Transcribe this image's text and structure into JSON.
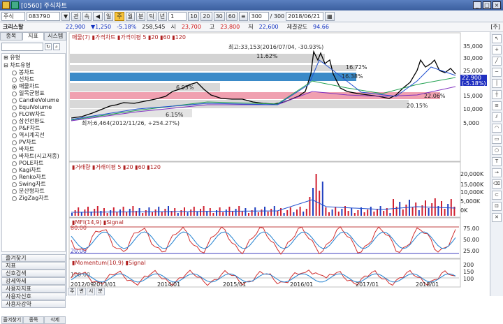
{
  "window": {
    "title": "[0560] 주식차트"
  },
  "toolbar": {
    "market": "주식",
    "code": "083790",
    "btn_kwan": "관",
    "btn_sok": "속",
    "period_day": "일",
    "period_week": "주",
    "period_month": "월",
    "period_minute": "분",
    "period_tick": "틱",
    "period_year": "년",
    "interval_value": "1",
    "presets": [
      "10",
      "20",
      "30",
      "60"
    ],
    "count_value": "300",
    "count_total": "/ 300",
    "date_value": "2018/06/21"
  },
  "quote": {
    "name": "크리스탈",
    "price": "22,900",
    "change": "▼1,250",
    "change_pct": "-5.18%",
    "volume": "258,545",
    "open_label": "시",
    "open": "23,700",
    "high_label": "고",
    "high": "23,800",
    "low_label": "저",
    "low": "22,600",
    "strength_label": "체결강도",
    "strength": "94.66",
    "tag": "[주]"
  },
  "sidebar": {
    "tabs": [
      "종목",
      "지표",
      "시스템"
    ],
    "active_tab": "지표",
    "groups": {
      "indicator": "유형",
      "chart_type": "차트유형"
    },
    "items": [
      "봉차트",
      "선차트",
      "매물차트",
      "일목균형표",
      "CandleVolume",
      "EquiVolume",
      "FLOW차트",
      "삼선전환도",
      "P&F차트",
      "역시계곡선",
      "PV차트",
      "바차트",
      "바차트(시고저종)",
      "POLE차트",
      "Kagi차트",
      "Renko차트",
      "Swing차트",
      "분산형차트",
      "ZigZag차트"
    ],
    "selected": "매물차트",
    "buttons": [
      "즐겨찾기",
      "지표",
      "신호검색",
      "강세약세",
      "사용자지표",
      "사용자신호",
      "사용자강약"
    ],
    "bottom": [
      "즐겨찾기",
      "종목",
      "삭제"
    ]
  },
  "panels": {
    "price_title": "매물(7) ▮가격차트 ▮가격이평 5 ▮20 ▮60 ▮120",
    "volume_title": "▮거래량 ▮거래이평 5 ▮20 ▮60 ▮120",
    "mfi_title": "▮MFI(14,9) ▮Signal",
    "momentum_title": "▮Momentum(10,9) ▮Signal"
  },
  "annotations": {
    "high": "최고:33,153(2016/07/04, -30.93%)",
    "low": "최저:6,464(2012/11/26, +254.27%)",
    "price_box_1": "22,900",
    "price_box_2": "(-5.18%)",
    "pct_labels": [
      "11.62%",
      "16.72%",
      "16.38%",
      "6.93%",
      "22.06%",
      "20.15%",
      "6.15%"
    ]
  },
  "axes": {
    "price_ticks": [
      "35,000",
      "30,000",
      "25,000",
      "15,000",
      "10,000",
      "5,000"
    ],
    "volume_ticks": [
      "20,000K",
      "15,000K",
      "10,000K",
      "5,000K",
      "0K"
    ],
    "mfi_ticks": [
      "75.00",
      "50.00",
      "25.00"
    ],
    "mfi_levels": [
      "80.00",
      "20.00"
    ],
    "momentum_ticks": [
      "200",
      "150",
      "100"
    ],
    "momentum_level": "100.00",
    "x_labels": [
      "2012/09",
      "2013/01",
      "2014/01",
      "2015/01",
      "2016/01",
      "2017/01",
      "2018/01"
    ]
  },
  "bottom_nav": [
    "주",
    "변",
    "시",
    "분"
  ],
  "colors": {
    "price_line": "#000000",
    "ma5": "#e03030",
    "ma20": "#2050d0",
    "ma60": "#20a050",
    "ma120": "#8030c0",
    "band_gray": "#c8c8c8",
    "band_blue": "#3a8ac8",
    "band_pink": "#f0a0b0",
    "mfi_line": "#d03030",
    "signal_line": "#2080d0"
  }
}
